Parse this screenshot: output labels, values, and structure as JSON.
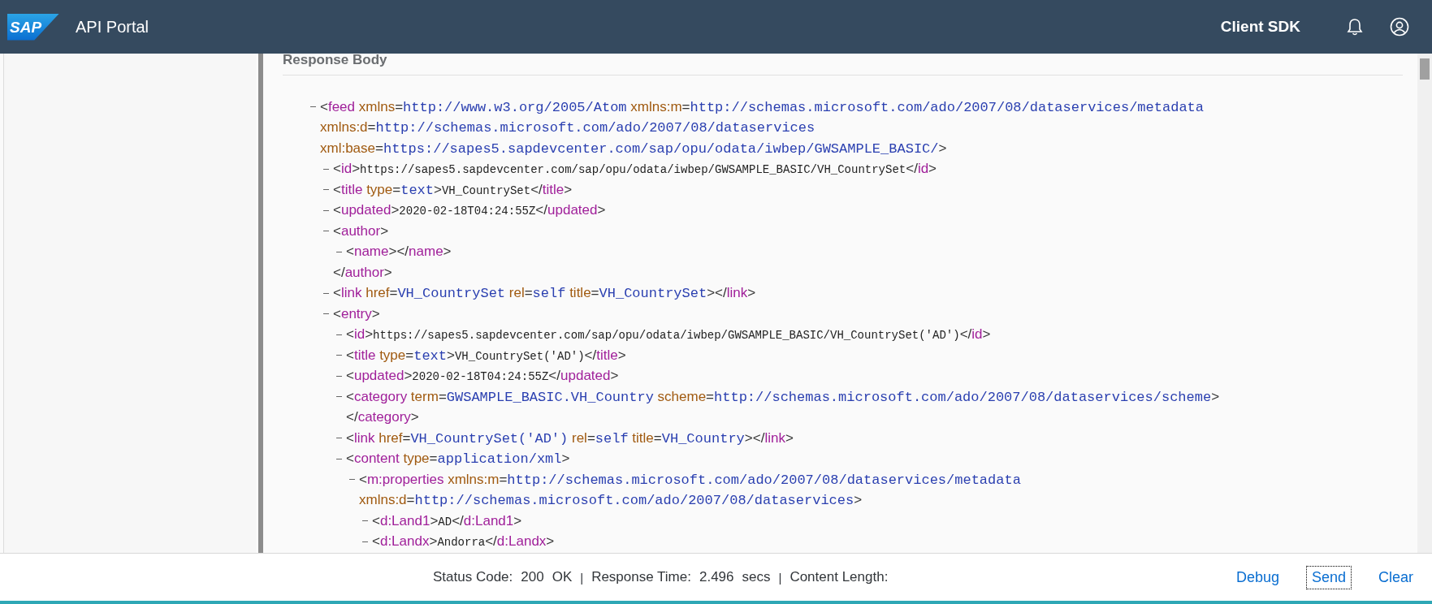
{
  "header": {
    "logo": "SAP",
    "title": "API Portal",
    "link": "Client SDK"
  },
  "response": {
    "title": "Response Body",
    "xml": {
      "expanded": true,
      "open": [
        [
          {
            "kind": "bracket",
            "text": "<"
          },
          {
            "kind": "tag",
            "text": "feed"
          },
          {
            "kind": "attr",
            "text": " xmlns"
          },
          {
            "kind": "bracket",
            "text": "="
          },
          {
            "kind": "value",
            "text": "http://www.w3.org/2005/Atom"
          },
          {
            "kind": "attr",
            "text": " xmlns:m"
          },
          {
            "kind": "bracket",
            "text": "="
          },
          {
            "kind": "value",
            "text": "http://schemas.microsoft.com/ado/2007/08/dataservices/metadata"
          }
        ],
        [
          {
            "kind": "attr",
            "text": "xmlns:d"
          },
          {
            "kind": "bracket",
            "text": "="
          },
          {
            "kind": "value",
            "text": "http://schemas.microsoft.com/ado/2007/08/dataservices"
          }
        ],
        [
          {
            "kind": "attr",
            "text": "xml:base"
          },
          {
            "kind": "bracket",
            "text": "="
          },
          {
            "kind": "value",
            "text": "https://sapes5.sapdevcenter.com/sap/opu/odata/iwbep/GWSAMPLE_BASIC/"
          },
          {
            "kind": "bracket",
            "text": ">"
          }
        ]
      ],
      "children": [
        {
          "expanded": true,
          "open": [
            [
              {
                "kind": "bracket",
                "text": "<"
              },
              {
                "kind": "tag",
                "text": "id"
              },
              {
                "kind": "bracket",
                "text": ">"
              },
              {
                "kind": "text",
                "text": "https://sapes5.sapdevcenter.com/sap/opu/odata/iwbep/GWSAMPLE_BASIC/VH_CountrySet"
              },
              {
                "kind": "bracket",
                "text": "</"
              },
              {
                "kind": "tag",
                "text": "id"
              },
              {
                "kind": "bracket",
                "text": ">"
              }
            ]
          ]
        },
        {
          "expanded": true,
          "open": [
            [
              {
                "kind": "bracket",
                "text": "<"
              },
              {
                "kind": "tag",
                "text": "title"
              },
              {
                "kind": "attr",
                "text": " type"
              },
              {
                "kind": "bracket",
                "text": "="
              },
              {
                "kind": "value",
                "text": "text"
              },
              {
                "kind": "bracket",
                "text": ">"
              },
              {
                "kind": "text",
                "text": "VH_CountrySet"
              },
              {
                "kind": "bracket",
                "text": "</"
              },
              {
                "kind": "tag",
                "text": "title"
              },
              {
                "kind": "bracket",
                "text": ">"
              }
            ]
          ]
        },
        {
          "expanded": true,
          "open": [
            [
              {
                "kind": "bracket",
                "text": "<"
              },
              {
                "kind": "tag",
                "text": "updated"
              },
              {
                "kind": "bracket",
                "text": ">"
              },
              {
                "kind": "text",
                "text": "2020-02-18T04:24:55Z"
              },
              {
                "kind": "bracket",
                "text": "</"
              },
              {
                "kind": "tag",
                "text": "updated"
              },
              {
                "kind": "bracket",
                "text": ">"
              }
            ]
          ]
        },
        {
          "expanded": true,
          "open": [
            [
              {
                "kind": "bracket",
                "text": "<"
              },
              {
                "kind": "tag",
                "text": "author"
              },
              {
                "kind": "bracket",
                "text": ">"
              }
            ]
          ],
          "children": [
            {
              "expanded": true,
              "open": [
                [
                  {
                    "kind": "bracket",
                    "text": "<"
                  },
                  {
                    "kind": "tag",
                    "text": "name"
                  },
                  {
                    "kind": "bracket",
                    "text": "></"
                  },
                  {
                    "kind": "tag",
                    "text": "name"
                  },
                  {
                    "kind": "bracket",
                    "text": ">"
                  }
                ]
              ]
            }
          ],
          "close": [
            [
              {
                "kind": "bracket",
                "text": "</"
              },
              {
                "kind": "tag",
                "text": "author"
              },
              {
                "kind": "bracket",
                "text": ">"
              }
            ]
          ]
        },
        {
          "expanded": true,
          "open": [
            [
              {
                "kind": "bracket",
                "text": "<"
              },
              {
                "kind": "tag",
                "text": "link"
              },
              {
                "kind": "attr",
                "text": " href"
              },
              {
                "kind": "bracket",
                "text": "="
              },
              {
                "kind": "value",
                "text": "VH_CountrySet"
              },
              {
                "kind": "attr",
                "text": " rel"
              },
              {
                "kind": "bracket",
                "text": "="
              },
              {
                "kind": "value",
                "text": "self"
              },
              {
                "kind": "attr",
                "text": " title"
              },
              {
                "kind": "bracket",
                "text": "="
              },
              {
                "kind": "value",
                "text": "VH_CountrySet"
              },
              {
                "kind": "bracket",
                "text": "></"
              },
              {
                "kind": "tag",
                "text": "link"
              },
              {
                "kind": "bracket",
                "text": ">"
              }
            ]
          ]
        },
        {
          "expanded": true,
          "open": [
            [
              {
                "kind": "bracket",
                "text": "<"
              },
              {
                "kind": "tag",
                "text": "entry"
              },
              {
                "kind": "bracket",
                "text": ">"
              }
            ]
          ],
          "children": [
            {
              "expanded": true,
              "open": [
                [
                  {
                    "kind": "bracket",
                    "text": "<"
                  },
                  {
                    "kind": "tag",
                    "text": "id"
                  },
                  {
                    "kind": "bracket",
                    "text": ">"
                  },
                  {
                    "kind": "text",
                    "text": "https://sapes5.sapdevcenter.com/sap/opu/odata/iwbep/GWSAMPLE_BASIC/VH_CountrySet('AD')"
                  },
                  {
                    "kind": "bracket",
                    "text": "</"
                  },
                  {
                    "kind": "tag",
                    "text": "id"
                  },
                  {
                    "kind": "bracket",
                    "text": ">"
                  }
                ]
              ]
            },
            {
              "expanded": true,
              "open": [
                [
                  {
                    "kind": "bracket",
                    "text": "<"
                  },
                  {
                    "kind": "tag",
                    "text": "title"
                  },
                  {
                    "kind": "attr",
                    "text": " type"
                  },
                  {
                    "kind": "bracket",
                    "text": "="
                  },
                  {
                    "kind": "value",
                    "text": "text"
                  },
                  {
                    "kind": "bracket",
                    "text": ">"
                  },
                  {
                    "kind": "text",
                    "text": "VH_CountrySet('AD')"
                  },
                  {
                    "kind": "bracket",
                    "text": "</"
                  },
                  {
                    "kind": "tag",
                    "text": "title"
                  },
                  {
                    "kind": "bracket",
                    "text": ">"
                  }
                ]
              ]
            },
            {
              "expanded": true,
              "open": [
                [
                  {
                    "kind": "bracket",
                    "text": "<"
                  },
                  {
                    "kind": "tag",
                    "text": "updated"
                  },
                  {
                    "kind": "bracket",
                    "text": ">"
                  },
                  {
                    "kind": "text",
                    "text": "2020-02-18T04:24:55Z"
                  },
                  {
                    "kind": "bracket",
                    "text": "</"
                  },
                  {
                    "kind": "tag",
                    "text": "updated"
                  },
                  {
                    "kind": "bracket",
                    "text": ">"
                  }
                ]
              ]
            },
            {
              "expanded": true,
              "open": [
                [
                  {
                    "kind": "bracket",
                    "text": "<"
                  },
                  {
                    "kind": "tag",
                    "text": "category"
                  },
                  {
                    "kind": "attr",
                    "text": " term"
                  },
                  {
                    "kind": "bracket",
                    "text": "="
                  },
                  {
                    "kind": "value",
                    "text": "GWSAMPLE_BASIC.VH_Country"
                  },
                  {
                    "kind": "attr",
                    "text": " scheme"
                  },
                  {
                    "kind": "bracket",
                    "text": "="
                  },
                  {
                    "kind": "value",
                    "text": "http://schemas.microsoft.com/ado/2007/08/dataservices/scheme"
                  },
                  {
                    "kind": "bracket",
                    "text": ">"
                  }
                ]
              ],
              "close": [
                [
                  {
                    "kind": "bracket",
                    "text": "</"
                  },
                  {
                    "kind": "tag",
                    "text": "category"
                  },
                  {
                    "kind": "bracket",
                    "text": ">"
                  }
                ]
              ]
            },
            {
              "expanded": true,
              "open": [
                [
                  {
                    "kind": "bracket",
                    "text": "<"
                  },
                  {
                    "kind": "tag",
                    "text": "link"
                  },
                  {
                    "kind": "attr",
                    "text": " href"
                  },
                  {
                    "kind": "bracket",
                    "text": "="
                  },
                  {
                    "kind": "value",
                    "text": "VH_CountrySet('AD')"
                  },
                  {
                    "kind": "attr",
                    "text": " rel"
                  },
                  {
                    "kind": "bracket",
                    "text": "="
                  },
                  {
                    "kind": "value",
                    "text": "self"
                  },
                  {
                    "kind": "attr",
                    "text": " title"
                  },
                  {
                    "kind": "bracket",
                    "text": "="
                  },
                  {
                    "kind": "value",
                    "text": "VH_Country"
                  },
                  {
                    "kind": "bracket",
                    "text": "></"
                  },
                  {
                    "kind": "tag",
                    "text": "link"
                  },
                  {
                    "kind": "bracket",
                    "text": ">"
                  }
                ]
              ]
            },
            {
              "expanded": true,
              "open": [
                [
                  {
                    "kind": "bracket",
                    "text": "<"
                  },
                  {
                    "kind": "tag",
                    "text": "content"
                  },
                  {
                    "kind": "attr",
                    "text": " type"
                  },
                  {
                    "kind": "bracket",
                    "text": "="
                  },
                  {
                    "kind": "value",
                    "text": "application/xml"
                  },
                  {
                    "kind": "bracket",
                    "text": ">"
                  }
                ]
              ],
              "children": [
                {
                  "expanded": true,
                  "open": [
                    [
                      {
                        "kind": "bracket",
                        "text": "<"
                      },
                      {
                        "kind": "tag",
                        "text": "m:properties"
                      },
                      {
                        "kind": "attr",
                        "text": " xmlns:m"
                      },
                      {
                        "kind": "bracket",
                        "text": "="
                      },
                      {
                        "kind": "value",
                        "text": "http://schemas.microsoft.com/ado/2007/08/dataservices/metadata"
                      }
                    ],
                    [
                      {
                        "kind": "attr",
                        "text": "xmlns:d"
                      },
                      {
                        "kind": "bracket",
                        "text": "="
                      },
                      {
                        "kind": "value",
                        "text": "http://schemas.microsoft.com/ado/2007/08/dataservices"
                      },
                      {
                        "kind": "bracket",
                        "text": ">"
                      }
                    ]
                  ],
                  "children": [
                    {
                      "expanded": true,
                      "open": [
                        [
                          {
                            "kind": "bracket",
                            "text": "<"
                          },
                          {
                            "kind": "tag",
                            "text": "d:Land1"
                          },
                          {
                            "kind": "bracket",
                            "text": ">"
                          },
                          {
                            "kind": "text",
                            "text": "AD"
                          },
                          {
                            "kind": "bracket",
                            "text": "</"
                          },
                          {
                            "kind": "tag",
                            "text": "d:Land1"
                          },
                          {
                            "kind": "bracket",
                            "text": ">"
                          }
                        ]
                      ]
                    },
                    {
                      "expanded": true,
                      "open": [
                        [
                          {
                            "kind": "bracket",
                            "text": "<"
                          },
                          {
                            "kind": "tag",
                            "text": "d:Landx"
                          },
                          {
                            "kind": "bracket",
                            "text": ">"
                          },
                          {
                            "kind": "text",
                            "text": "Andorra"
                          },
                          {
                            "kind": "bracket",
                            "text": "</"
                          },
                          {
                            "kind": "tag",
                            "text": "d:Landx"
                          },
                          {
                            "kind": "bracket",
                            "text": ">"
                          }
                        ]
                      ]
                    }
                  ]
                }
              ]
            }
          ]
        }
      ]
    }
  },
  "footer": {
    "status": [
      {
        "kind": "label",
        "text": "Status Code:"
      },
      {
        "kind": "value",
        "text": "200"
      },
      {
        "kind": "value",
        "text": "OK"
      },
      {
        "kind": "separator",
        "text": "|"
      },
      {
        "kind": "label",
        "text": "Response Time:"
      },
      {
        "kind": "value",
        "text": "2.496"
      },
      {
        "kind": "value",
        "text": "secs"
      },
      {
        "kind": "separator",
        "text": "|"
      },
      {
        "kind": "label",
        "text": "Content Length:"
      }
    ],
    "buttons": [
      {
        "label": "Debug",
        "focused": false
      },
      {
        "label": "Send",
        "focused": true
      },
      {
        "label": "Clear",
        "focused": false
      }
    ]
  }
}
